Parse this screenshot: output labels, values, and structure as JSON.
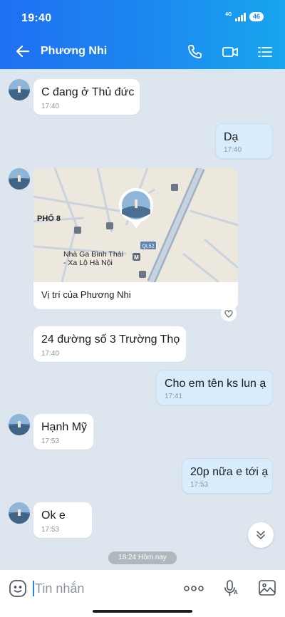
{
  "status_bar": {
    "time": "19:40",
    "network": "4G",
    "battery": "46"
  },
  "header": {
    "back_icon": "arrow-left-icon",
    "contact_name": "Phương Nhi",
    "actions": [
      "phone-icon",
      "video-call-icon",
      "menu-list-icon"
    ]
  },
  "messages": [
    {
      "side": "in",
      "text": "C đang ở Thủ đức",
      "time": "17:40"
    },
    {
      "side": "out",
      "text": "Dạ",
      "time": "17:40"
    },
    {
      "side": "in",
      "type": "location",
      "caption": "Vị trí của Phương Nhi",
      "map_labels": [
        "PHỐ 8",
        "Nhà Ga Bình Thái",
        "- Xa Lộ Hà Nội",
        "QL52"
      ]
    },
    {
      "side": "in",
      "text": "24 đường số 3 Trường Thọ",
      "time": "17:40"
    },
    {
      "side": "out",
      "text": "Cho em tên ks lun ạ",
      "time": "17:41"
    },
    {
      "side": "in",
      "text": "Hạnh Mỹ",
      "time": "17:53"
    },
    {
      "side": "out",
      "text": "20p nữa e tới ạ",
      "time": "17:53"
    },
    {
      "side": "in",
      "text": "Ok e",
      "time": "17:53"
    }
  ],
  "time_separator": "18:24 Hôm nay",
  "composer": {
    "placeholder": "Tin nhắn",
    "icons": [
      "sticker-icon",
      "more-icon",
      "voice-input-icon",
      "image-icon"
    ]
  },
  "colors": {
    "header_start": "#1f6ff2",
    "header_end": "#18a6ee",
    "outgoing_bubble": "#d8ecfb",
    "chat_bg": "#dde6ee"
  }
}
